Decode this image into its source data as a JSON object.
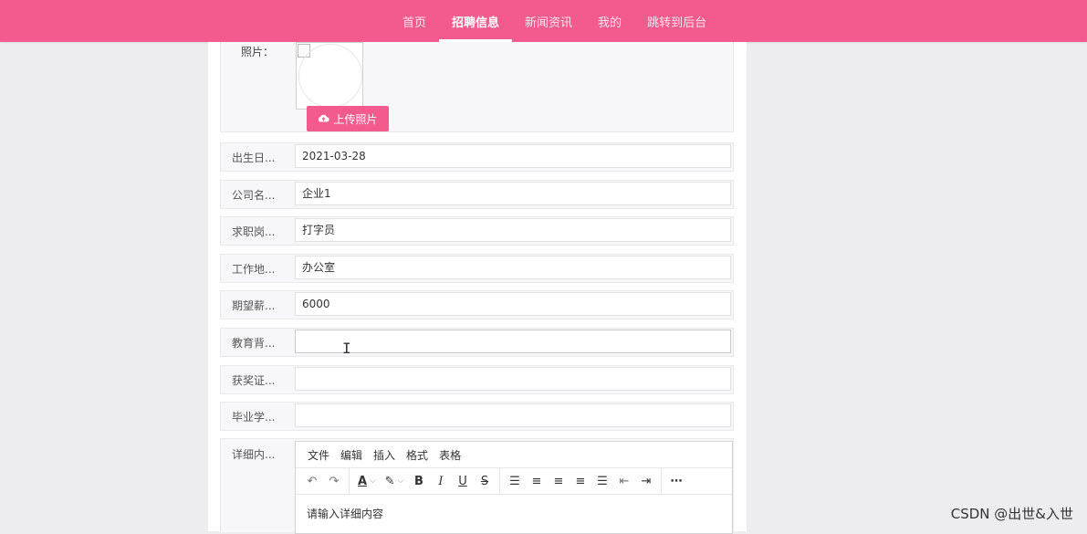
{
  "nav": {
    "items": [
      "首页",
      "招聘信息",
      "新闻资讯",
      "我的",
      "跳转到后台"
    ],
    "active_index": 1
  },
  "photo": {
    "label": "照片：",
    "upload_label": "上传照片"
  },
  "fields": [
    {
      "label": "出生日...",
      "value": "2021-03-28"
    },
    {
      "label": "公司名...",
      "value": "企业1"
    },
    {
      "label": "求职岗...",
      "value": "打字员"
    },
    {
      "label": "工作地...",
      "value": "办公室"
    },
    {
      "label": "期望薪...",
      "value": "6000"
    },
    {
      "label": "教育背...",
      "value": ""
    },
    {
      "label": "获奖证...",
      "value": ""
    },
    {
      "label": "毕业学...",
      "value": ""
    }
  ],
  "editor": {
    "label": "详细内...",
    "menu": [
      "文件",
      "编辑",
      "插入",
      "格式",
      "表格"
    ],
    "placeholder": "请输入详细内容"
  },
  "colors": {
    "brand": "#f35b8e"
  },
  "watermark": "CSDN @出世&入世"
}
